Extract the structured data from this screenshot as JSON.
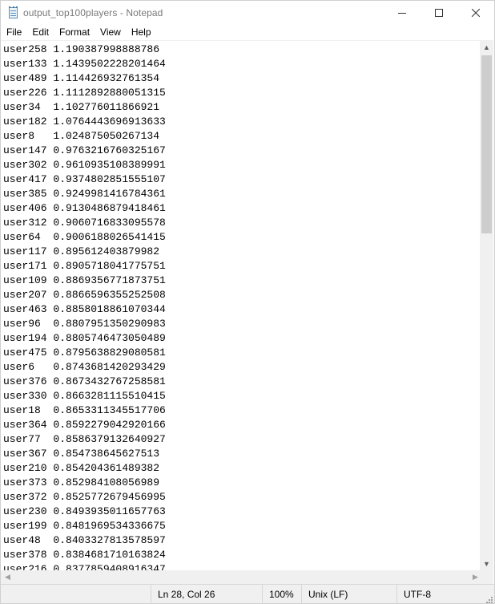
{
  "window": {
    "title": "output_top100players - Notepad",
    "minimize_glyph": "—",
    "maximize_glyph": "☐",
    "close_glyph": "✕"
  },
  "menu": {
    "file": "File",
    "edit": "Edit",
    "format": "Format",
    "view": "View",
    "help": "Help"
  },
  "editor": {
    "lines": [
      "user258 1.190387998888786",
      "user133 1.1439502228201464",
      "user489 1.114426932761354",
      "user226 1.1112892880051315",
      "user34  1.102776011866921",
      "user182 1.0764443696913633",
      "user8   1.024875050267134",
      "user147 0.9763216760325167",
      "user302 0.9610935108389991",
      "user417 0.9374802851555107",
      "user385 0.9249981416784361",
      "user406 0.9130486879418461",
      "user312 0.9060716833095578",
      "user64  0.9006188026541415",
      "user117 0.895612403879982",
      "user171 0.8905718041775751",
      "user109 0.8869356771873751",
      "user207 0.8866596355252508",
      "user463 0.8858018861070344",
      "user96  0.8807951350290983",
      "user194 0.8805746473050489",
      "user475 0.8795638829080581",
      "user6   0.8743681420293429",
      "user376 0.8673432767258581",
      "user330 0.8663281115510415",
      "user18  0.8653311345517706",
      "user364 0.8592279042920166",
      "user77  0.8586379132640927",
      "user367 0.854738645627513",
      "user210 0.854204361489382",
      "user373 0.852984108056989",
      "user372 0.8525772679456995",
      "user230 0.8493935011657763",
      "user199 0.8481969534336675",
      "user48  0.8403327813578597",
      "user378 0.8384681710163824",
      "user216 0.8377859408916347"
    ]
  },
  "statusbar": {
    "position": "Ln 28, Col 26",
    "zoom": "100%",
    "line_ending": "Unix (LF)",
    "encoding": "UTF-8"
  },
  "icons": {
    "app": "notepad-icon",
    "scroll_up": "chevron-up-icon",
    "scroll_down": "chevron-down-icon",
    "scroll_left": "chevron-left-icon",
    "scroll_right": "chevron-right-icon"
  },
  "scroll_arrows": {
    "up": "▲",
    "down": "▼",
    "left": "◀",
    "right": "▶"
  }
}
